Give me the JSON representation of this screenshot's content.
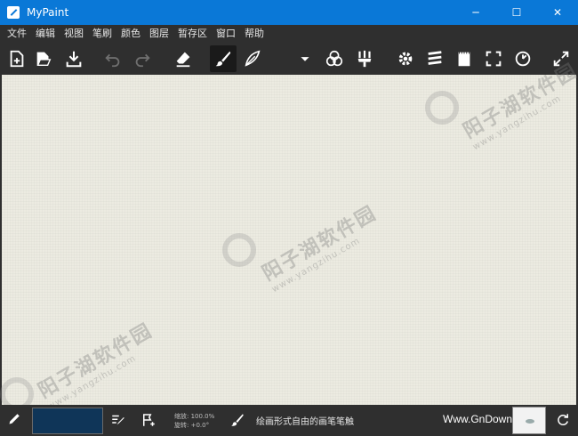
{
  "window": {
    "title": "MyPaint",
    "minimize": "─",
    "maximize": "☐",
    "close": "✕"
  },
  "menu": [
    "文件",
    "编辑",
    "视图",
    "笔刷",
    "颜色",
    "图层",
    "暂存区",
    "窗口",
    "帮助"
  ],
  "toolbar": {
    "icons": [
      "new-document-icon",
      "open-file-icon",
      "save-download-icon",
      "undo-icon",
      "redo-icon",
      "eraser-icon",
      "brush-icon",
      "feather-brush-icon",
      "dropdown-icon",
      "color-circles-icon",
      "brush-set-icon",
      "settings-gear-icon",
      "layers-icon",
      "scratchpad-icon",
      "fullscreen-icon",
      "rotate-reset-icon",
      "expand-icon"
    ],
    "active": "brush-icon",
    "color": "#ffffff",
    "dim_color": "#6f6f6f"
  },
  "watermark": {
    "text": "阳子湖软件园",
    "url": "www.yangzihu.com"
  },
  "status": {
    "current_color": "#0f3558",
    "zoom_label": "缩放:",
    "zoom_value": "100.0%",
    "rotate_label": "旋转:",
    "rotate_value": "+0.0°",
    "brush_description": "绘画形式自由的画笔笔触",
    "site": "Www.GnDown.Com"
  },
  "colors": {
    "titlebar": "#0a78d7",
    "toolbar_bg": "#2f2f2f",
    "canvas": "#ecebe1"
  }
}
